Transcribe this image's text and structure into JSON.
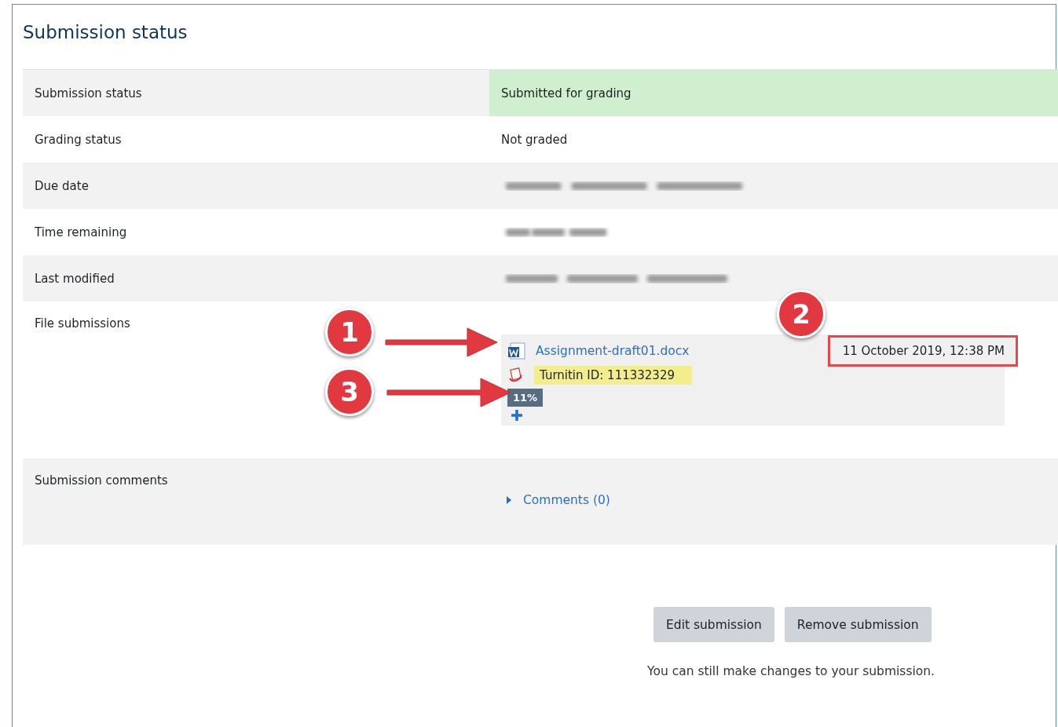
{
  "title": "Submission status",
  "rows": [
    {
      "label": "Submission status",
      "kind": "text",
      "value": "Submitted for grading",
      "highlighted": true
    },
    {
      "label": "Grading status",
      "kind": "text",
      "value": "Not graded",
      "highlighted": false
    },
    {
      "label": "Due date",
      "kind": "blurred"
    },
    {
      "label": "Time remaining",
      "kind": "blurred"
    },
    {
      "label": "Last modified",
      "kind": "blurred"
    },
    {
      "label": "File submissions",
      "kind": "files",
      "files": [
        {
          "name": "Assignment-draft01.docx",
          "date": "11 October 2019, 12:38 PM",
          "turnitin_id": "Turnitin ID: 111332329",
          "similarity": "11%"
        }
      ]
    },
    {
      "label": "Submission comments",
      "kind": "comments",
      "link": "Comments (0)",
      "expanded": false
    }
  ],
  "callouts": [
    {
      "number": "1",
      "arrow": true
    },
    {
      "number": "2",
      "arrow": false
    },
    {
      "number": "3",
      "arrow": true
    }
  ],
  "buttons": [
    "Edit submission",
    "Remove submission"
  ],
  "note": "You can still make changes to your submission."
}
